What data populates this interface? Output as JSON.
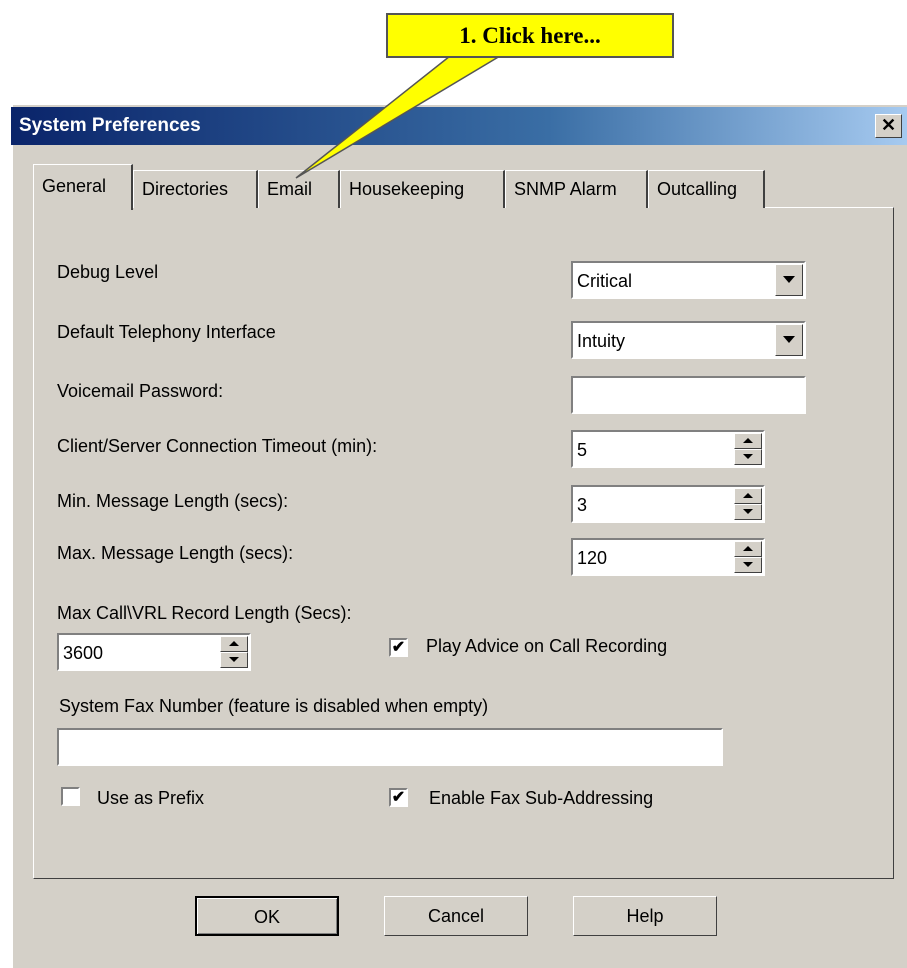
{
  "callout": {
    "text": "1. Click here..."
  },
  "window": {
    "title": "System Preferences",
    "close_glyph": "✕"
  },
  "tabs": [
    {
      "label": "General",
      "active": true
    },
    {
      "label": "Directories"
    },
    {
      "label": "Email"
    },
    {
      "label": "Housekeeping"
    },
    {
      "label": "SNMP Alarm"
    },
    {
      "label": "Outcalling"
    }
  ],
  "fields": {
    "debug_level": {
      "label": "Debug Level",
      "value": "Critical"
    },
    "telephony": {
      "label": "Default Telephony Interface",
      "value": "Intuity"
    },
    "vm_password": {
      "label": "Voicemail Password:",
      "value": ""
    },
    "timeout": {
      "label": "Client/Server Connection Timeout (min):",
      "value": "5"
    },
    "min_len": {
      "label": "Min. Message Length (secs):",
      "value": "3"
    },
    "max_len": {
      "label": "Max. Message Length (secs):",
      "value": "120"
    },
    "max_call": {
      "label": "Max Call\\VRL Record Length (Secs):",
      "value": "3600"
    },
    "play_advice": {
      "label": "Play Advice on Call Recording",
      "checked": true
    },
    "fax_number": {
      "label": "System Fax Number (feature is disabled when empty)",
      "value": ""
    },
    "use_prefix": {
      "label": "Use as Prefix",
      "checked": false
    },
    "fax_subaddr": {
      "label": "Enable Fax Sub-Addressing",
      "checked": true
    }
  },
  "buttons": {
    "ok": "OK",
    "cancel": "Cancel",
    "help": "Help"
  },
  "colors": {
    "callout": "#ffff00",
    "titlebar_start": "#0a246a",
    "titlebar_end": "#a6caf0",
    "face": "#d4d0c8"
  }
}
